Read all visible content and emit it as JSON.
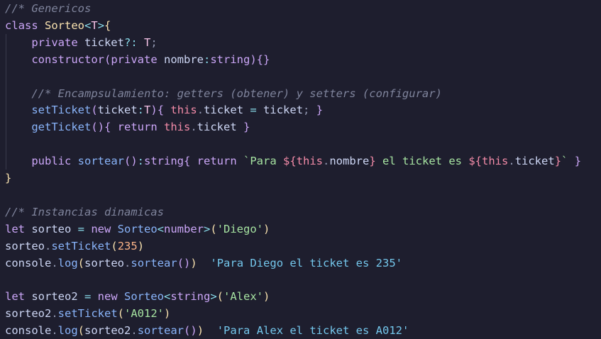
{
  "editor": {
    "lines": [
      [
        {
          "t": "//* Genericos",
          "c": "cm"
        }
      ],
      [
        {
          "t": "class ",
          "c": "kw"
        },
        {
          "t": "Sorteo",
          "c": "cls"
        },
        {
          "t": "<",
          "c": "op"
        },
        {
          "t": "T",
          "c": "tp"
        },
        {
          "t": ">",
          "c": "op"
        },
        {
          "t": "{",
          "c": "b1"
        }
      ],
      [
        {
          "t": "    "
        },
        {
          "t": "private ",
          "c": "kw"
        },
        {
          "t": "ticket",
          "c": "pr"
        },
        {
          "t": "?: ",
          "c": "op"
        },
        {
          "t": "T",
          "c": "tp"
        },
        {
          "t": ";",
          "c": "pu"
        }
      ],
      [
        {
          "t": "    "
        },
        {
          "t": "constructor",
          "c": "kw"
        },
        {
          "t": "(",
          "c": "b2"
        },
        {
          "t": "private ",
          "c": "kw"
        },
        {
          "t": "nombre",
          "c": "pr"
        },
        {
          "t": ":",
          "c": "op"
        },
        {
          "t": "string",
          "c": "kw"
        },
        {
          "t": ")",
          "c": "b2"
        },
        {
          "t": "{}",
          "c": "b2"
        }
      ],
      [],
      [
        {
          "t": "    "
        },
        {
          "t": "//* Encampsulamiento: getters (obtener) y setters (configurar)",
          "c": "cm"
        }
      ],
      [
        {
          "t": "    "
        },
        {
          "t": "setTicket",
          "c": "fn"
        },
        {
          "t": "(",
          "c": "b2"
        },
        {
          "t": "ticket",
          "c": "pr"
        },
        {
          "t": ":",
          "c": "op"
        },
        {
          "t": "T",
          "c": "tp"
        },
        {
          "t": ")",
          "c": "b2"
        },
        {
          "t": "{ ",
          "c": "b2"
        },
        {
          "t": "this",
          "c": "this"
        },
        {
          "t": ".",
          "c": "pu"
        },
        {
          "t": "ticket ",
          "c": "pr"
        },
        {
          "t": "= ",
          "c": "op"
        },
        {
          "t": "ticket",
          "c": "pr"
        },
        {
          "t": "; ",
          "c": "pu"
        },
        {
          "t": "}",
          "c": "b2"
        }
      ],
      [
        {
          "t": "    "
        },
        {
          "t": "getTicket",
          "c": "fn"
        },
        {
          "t": "()",
          "c": "b2"
        },
        {
          "t": "{ ",
          "c": "b2"
        },
        {
          "t": "return ",
          "c": "kw"
        },
        {
          "t": "this",
          "c": "this"
        },
        {
          "t": ".",
          "c": "pu"
        },
        {
          "t": "ticket ",
          "c": "pr"
        },
        {
          "t": "}",
          "c": "b2"
        }
      ],
      [],
      [
        {
          "t": "    "
        },
        {
          "t": "public ",
          "c": "kw"
        },
        {
          "t": "sortear",
          "c": "fn"
        },
        {
          "t": "()",
          "c": "b2"
        },
        {
          "t": ":",
          "c": "op"
        },
        {
          "t": "string",
          "c": "kw"
        },
        {
          "t": "{ ",
          "c": "b2"
        },
        {
          "t": "return ",
          "c": "kw"
        },
        {
          "t": "`Para ",
          "c": "st"
        },
        {
          "t": "${",
          "c": "intp"
        },
        {
          "t": "this",
          "c": "this"
        },
        {
          "t": ".",
          "c": "pu"
        },
        {
          "t": "nombre",
          "c": "pr"
        },
        {
          "t": "}",
          "c": "intp"
        },
        {
          "t": " el ticket es ",
          "c": "st"
        },
        {
          "t": "${",
          "c": "intp"
        },
        {
          "t": "this",
          "c": "this"
        },
        {
          "t": ".",
          "c": "pu"
        },
        {
          "t": "ticket",
          "c": "pr"
        },
        {
          "t": "}",
          "c": "intp"
        },
        {
          "t": "` ",
          "c": "st"
        },
        {
          "t": "}",
          "c": "b2"
        }
      ],
      [
        {
          "t": "}",
          "c": "b1"
        }
      ],
      [],
      [
        {
          "t": "//* Instancias dinamicas",
          "c": "cm"
        }
      ],
      [
        {
          "t": "let ",
          "c": "kw"
        },
        {
          "t": "sorteo ",
          "c": "pr"
        },
        {
          "t": "= ",
          "c": "op"
        },
        {
          "t": "new ",
          "c": "kw"
        },
        {
          "t": "Sorteo",
          "c": "fn"
        },
        {
          "t": "<",
          "c": "op"
        },
        {
          "t": "number",
          "c": "kw"
        },
        {
          "t": ">",
          "c": "op"
        },
        {
          "t": "(",
          "c": "b1"
        },
        {
          "t": "'Diego'",
          "c": "st"
        },
        {
          "t": ")",
          "c": "b1"
        }
      ],
      [
        {
          "t": "sorteo",
          "c": "pr"
        },
        {
          "t": ".",
          "c": "pu"
        },
        {
          "t": "setTicket",
          "c": "fn"
        },
        {
          "t": "(",
          "c": "b1"
        },
        {
          "t": "235",
          "c": "nu"
        },
        {
          "t": ")",
          "c": "b1"
        }
      ],
      [
        {
          "t": "console",
          "c": "pr"
        },
        {
          "t": ".",
          "c": "pu"
        },
        {
          "t": "log",
          "c": "fn"
        },
        {
          "t": "(",
          "c": "b1"
        },
        {
          "t": "sorteo",
          "c": "pr"
        },
        {
          "t": ".",
          "c": "pu"
        },
        {
          "t": "sortear",
          "c": "fn"
        },
        {
          "t": "()",
          "c": "b2"
        },
        {
          "t": ")",
          "c": "b1"
        },
        {
          "t": "  "
        },
        {
          "t": "'Para Diego el ticket es 235'",
          "c": "res"
        }
      ],
      [],
      [
        {
          "t": "let ",
          "c": "kw"
        },
        {
          "t": "sorteo2 ",
          "c": "pr"
        },
        {
          "t": "= ",
          "c": "op"
        },
        {
          "t": "new ",
          "c": "kw"
        },
        {
          "t": "Sorteo",
          "c": "fn"
        },
        {
          "t": "<",
          "c": "op"
        },
        {
          "t": "string",
          "c": "kw"
        },
        {
          "t": ">",
          "c": "op"
        },
        {
          "t": "(",
          "c": "b1"
        },
        {
          "t": "'Alex'",
          "c": "st"
        },
        {
          "t": ")",
          "c": "b1"
        }
      ],
      [
        {
          "t": "sorteo2",
          "c": "pr"
        },
        {
          "t": ".",
          "c": "pu"
        },
        {
          "t": "setTicket",
          "c": "fn"
        },
        {
          "t": "(",
          "c": "b1"
        },
        {
          "t": "'A012'",
          "c": "st"
        },
        {
          "t": ")",
          "c": "b1"
        }
      ],
      [
        {
          "t": "console",
          "c": "pr"
        },
        {
          "t": ".",
          "c": "pu"
        },
        {
          "t": "log",
          "c": "fn"
        },
        {
          "t": "(",
          "c": "b1"
        },
        {
          "t": "sorteo2",
          "c": "pr"
        },
        {
          "t": ".",
          "c": "pu"
        },
        {
          "t": "sortear",
          "c": "fn"
        },
        {
          "t": "()",
          "c": "b2"
        },
        {
          "t": ")",
          "c": "b1"
        },
        {
          "t": "  "
        },
        {
          "t": "'Para Alex el ticket es A012'",
          "c": "res"
        }
      ]
    ]
  }
}
